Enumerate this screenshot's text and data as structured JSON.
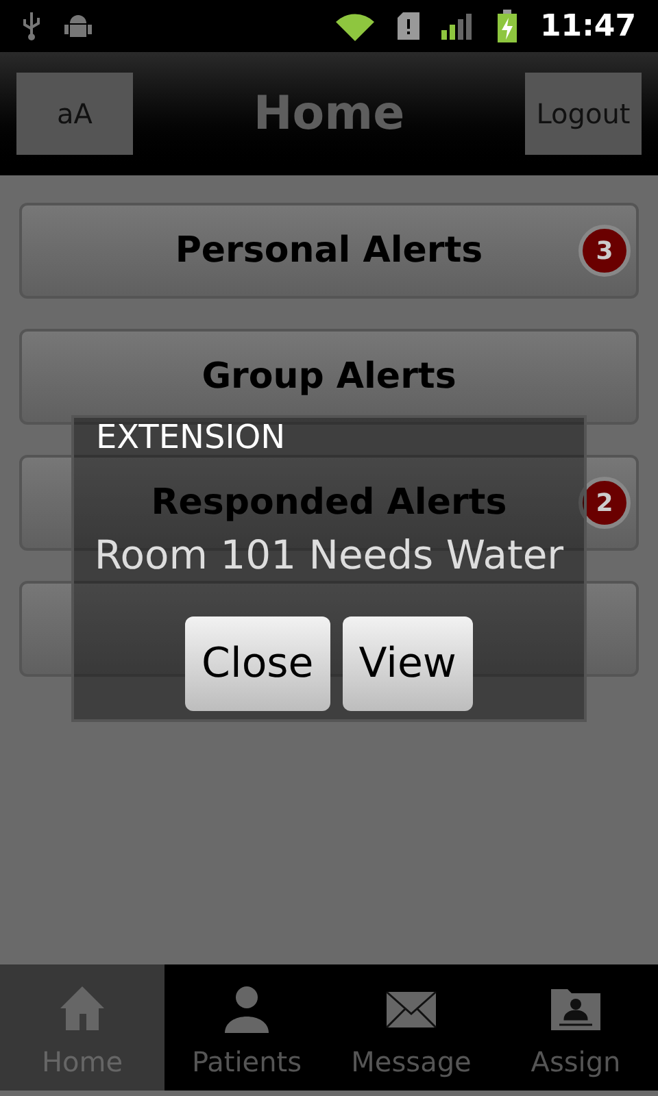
{
  "status_bar": {
    "time": "11:47"
  },
  "header": {
    "title": "Home",
    "left_button": "aA",
    "right_button": "Logout"
  },
  "alerts": [
    {
      "kind": "labelled",
      "label": "Personal Alerts",
      "badge": "3"
    },
    {
      "kind": "labelled",
      "label": "Group Alerts"
    },
    {
      "kind": "labelled",
      "label": "Responded Alerts",
      "badge": "2"
    },
    {
      "kind": "blank"
    }
  ],
  "dialog": {
    "title": "EXTENSION",
    "message": "Room 101 Needs Water",
    "buttons": [
      "Close",
      "View"
    ]
  },
  "tabs": [
    {
      "label": "Home",
      "selected": true
    },
    {
      "label": "Patients",
      "selected": false
    },
    {
      "label": "Message",
      "selected": false
    },
    {
      "label": "Assign",
      "selected": false
    }
  ]
}
